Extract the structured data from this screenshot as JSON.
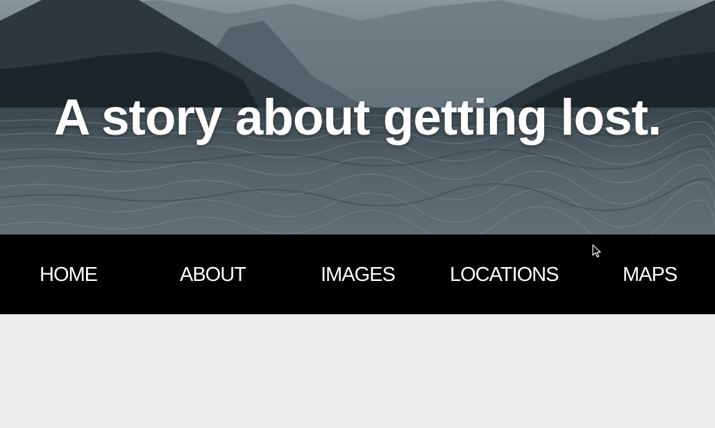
{
  "hero": {
    "title": "A story about getting lost."
  },
  "nav": {
    "items": [
      {
        "label": "HOME"
      },
      {
        "label": "ABOUT"
      },
      {
        "label": "IMAGES"
      },
      {
        "label": "LOCATIONS"
      },
      {
        "label": "MAPS"
      }
    ]
  },
  "colors": {
    "nav_background": "#000000",
    "nav_text": "#ffffff",
    "content_background": "#eeeeee",
    "hero_title": "#ffffff"
  }
}
